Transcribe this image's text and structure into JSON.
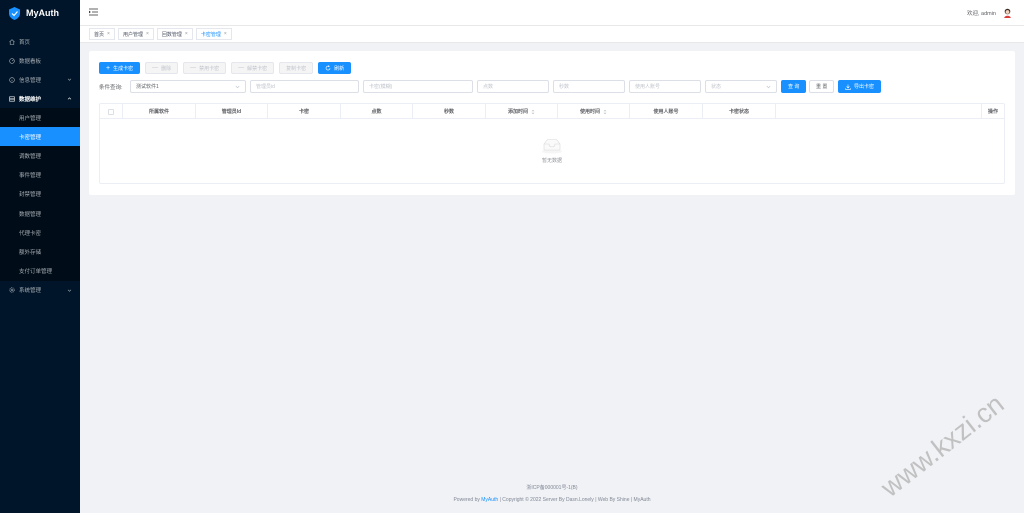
{
  "app": {
    "name": "MyAuth"
  },
  "sidebar": {
    "items": [
      {
        "label": "首页",
        "icon": "home-icon"
      },
      {
        "label": "数据看板",
        "icon": "dashboard-icon"
      },
      {
        "label": "信息管理",
        "icon": "info-icon",
        "has_caret": true
      },
      {
        "label": "数据维护",
        "icon": "database-icon",
        "open": true
      }
    ],
    "sub_items": [
      {
        "label": "用户管理"
      },
      {
        "label": "卡密管理",
        "active": true
      },
      {
        "label": "调数管理"
      },
      {
        "label": "事件管理"
      },
      {
        "label": "封禁管理"
      },
      {
        "label": "数据管理"
      },
      {
        "label": "代理卡密"
      },
      {
        "label": "额外存储"
      },
      {
        "label": "支付订单管理"
      }
    ],
    "bottom_item": {
      "label": "系统管理",
      "icon": "settings-icon"
    }
  },
  "header": {
    "welcome": "欢迎,",
    "username": "admin"
  },
  "tabs": [
    {
      "label": "首页"
    },
    {
      "label": "用户管理"
    },
    {
      "label": "回数管理"
    },
    {
      "label": "卡密管理",
      "active": true
    }
  ],
  "toolbar": {
    "generate": "生成卡密",
    "delete": "删除",
    "disable": "禁用卡密",
    "unban": "解禁卡密",
    "copy": "复制卡密",
    "refresh": "刷新"
  },
  "query": {
    "label": "条件查询:",
    "software_value": "测试软件1",
    "admin_id_placeholder": "管理员id",
    "card_placeholder": "卡密(模糊)",
    "points_placeholder": "点数",
    "seconds_placeholder": "秒数",
    "user_placeholder": "使用人账号",
    "status_placeholder": "状态",
    "search": "查 询",
    "reset": "重 置",
    "export": "导出卡密"
  },
  "table": {
    "columns": [
      "所属软件",
      "管理员Id",
      "卡密",
      "点数",
      "秒数",
      "添加时间",
      "使用时间",
      "使用人账号",
      "卡密状态",
      "操作"
    ],
    "empty_text": "暂无数据"
  },
  "footer": {
    "icp": "浙ICP备000001号-1(B)",
    "powered_prefix": "Powered by",
    "powered_brand": "MyAuth",
    "copyright": "| Copyright © 2022 Server By Dasn.Lonely | Web By Shine | MyAuth"
  },
  "watermark": {
    "text": "www.kxzi.cn"
  },
  "colors": {
    "primary": "#1890ff",
    "sidebar_bg": "#001529"
  }
}
